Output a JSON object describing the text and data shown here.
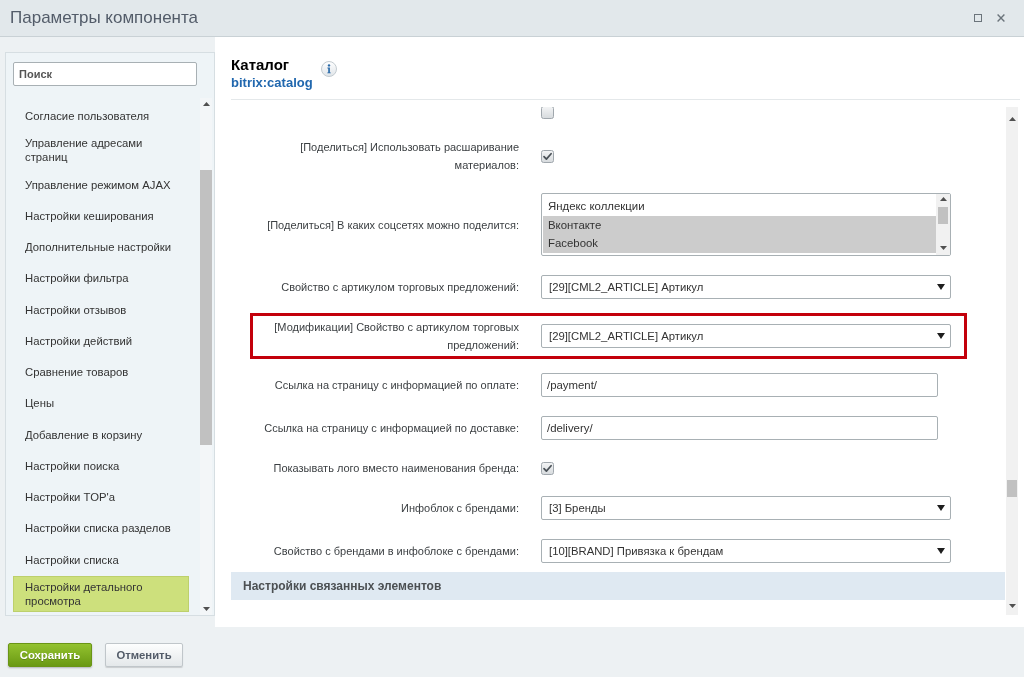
{
  "window": {
    "title": "Параметры компонента"
  },
  "sidebar": {
    "search": {
      "placeholder": "Поиск"
    },
    "items": [
      {
        "label": "Согласие пользователя",
        "selected": false
      },
      {
        "label": "Управление адресами страниц",
        "selected": false
      },
      {
        "label": "Управление режимом AJAX",
        "selected": false
      },
      {
        "label": "Настройки кеширования",
        "selected": false
      },
      {
        "label": "Дополнительные настройки",
        "selected": false
      },
      {
        "label": "Настройки фильтра",
        "selected": false
      },
      {
        "label": "Настройки отзывов",
        "selected": false
      },
      {
        "label": "Настройки действий",
        "selected": false
      },
      {
        "label": "Сравнение товаров",
        "selected": false
      },
      {
        "label": "Цены",
        "selected": false
      },
      {
        "label": "Добавление в корзину",
        "selected": false
      },
      {
        "label": "Настройки поиска",
        "selected": false
      },
      {
        "label": "Настройки TOP'a",
        "selected": false
      },
      {
        "label": "Настройки списка разделов",
        "selected": false
      },
      {
        "label": "Настройки списка",
        "selected": false
      },
      {
        "label": "Настройки детального просмотра",
        "selected": true
      }
    ]
  },
  "component": {
    "title": "Каталог",
    "code": "bitrix:catalog"
  },
  "settings": [
    {
      "kind": "checkbox",
      "checked": false,
      "highlighted": false
    },
    {
      "kind": "checkbox",
      "label": "[Поделиться] Использовать расшаривание материалов:",
      "checked": true,
      "highlighted": false
    },
    {
      "kind": "listbox",
      "label": "[Поделиться] В каких соцсетях можно поделится:",
      "options": [
        {
          "label": "Яндекс коллекции",
          "selected": false
        },
        {
          "label": "Вконтакте",
          "selected": true
        },
        {
          "label": "Facebook",
          "selected": true
        }
      ],
      "highlighted": false
    },
    {
      "kind": "select",
      "label": "Свойство с артикулом торговых предложений:",
      "value": "[29][CML2_ARTICLE] Артикул",
      "highlighted": false
    },
    {
      "kind": "select",
      "label": "[Модификации] Свойство с артикулом торговых предложений:",
      "value": "[29][CML2_ARTICLE] Артикул",
      "highlighted": true
    },
    {
      "kind": "input",
      "label": "Ссылка на страницу с информацией по оплате:",
      "value": "/payment/",
      "highlighted": false
    },
    {
      "kind": "input",
      "label": "Ссылка на страницу с информацией по доставке:",
      "value": "/delivery/",
      "highlighted": false
    },
    {
      "kind": "checkbox",
      "label": "Показывать лого вместо наименования бренда:",
      "checked": true,
      "highlighted": false
    },
    {
      "kind": "select",
      "label": "Инфоблок с брендами:",
      "value": "[3] Бренды",
      "highlighted": false
    },
    {
      "kind": "select",
      "label": "Свойство с брендами в инфоблоке с брендами:",
      "value": "[10][BRAND] Привязка к брендам",
      "highlighted": false
    },
    {
      "kind": "section",
      "title": "Настройки связанных элементов"
    }
  ],
  "buttons": [
    {
      "kind": "primary",
      "label": "Сохранить"
    },
    {
      "kind": "secondary",
      "label": "Отменить"
    }
  ]
}
